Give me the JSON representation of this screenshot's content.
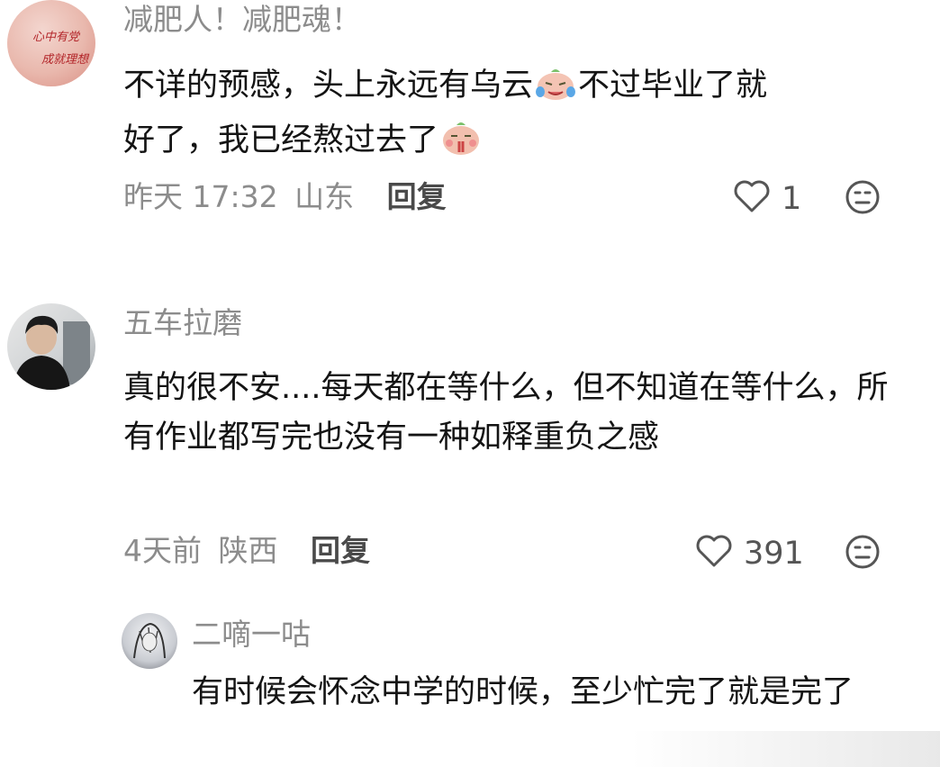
{
  "comments": [
    {
      "username": "减肥人！减肥魂！",
      "avatar_text": [
        "心中有党",
        "成就理想"
      ],
      "content_part1": "不详的预感，头上永远有乌云",
      "content_part2": "不过毕业了就",
      "content_part3": "好了，我已经熬过去了",
      "time": "昨天 17:32",
      "location": "山东",
      "reply_label": "回复",
      "like_count": "1",
      "emojis": [
        "crying-peach-emoji",
        "praying-peach-emoji"
      ]
    },
    {
      "username": "五车拉磨",
      "content": "真的很不安....每天都在等什么，但不知道在等什么，所有作业都写完也没有一种如释重负之感",
      "time": "4天前",
      "location": "陕西",
      "reply_label": "回复",
      "like_count": "391"
    }
  ],
  "sub_comments": [
    {
      "username": "二嘀一咕",
      "content": "有时候会怀念中学的时候，至少忙完了就是完了"
    }
  ],
  "icons": {
    "like": "heart-outline-icon",
    "dislike": "neutral-face-icon"
  },
  "colors": {
    "username": "#8c8c8c",
    "content": "#141414",
    "meta": "#8c8c8c",
    "reply": "#4a4a4a"
  }
}
